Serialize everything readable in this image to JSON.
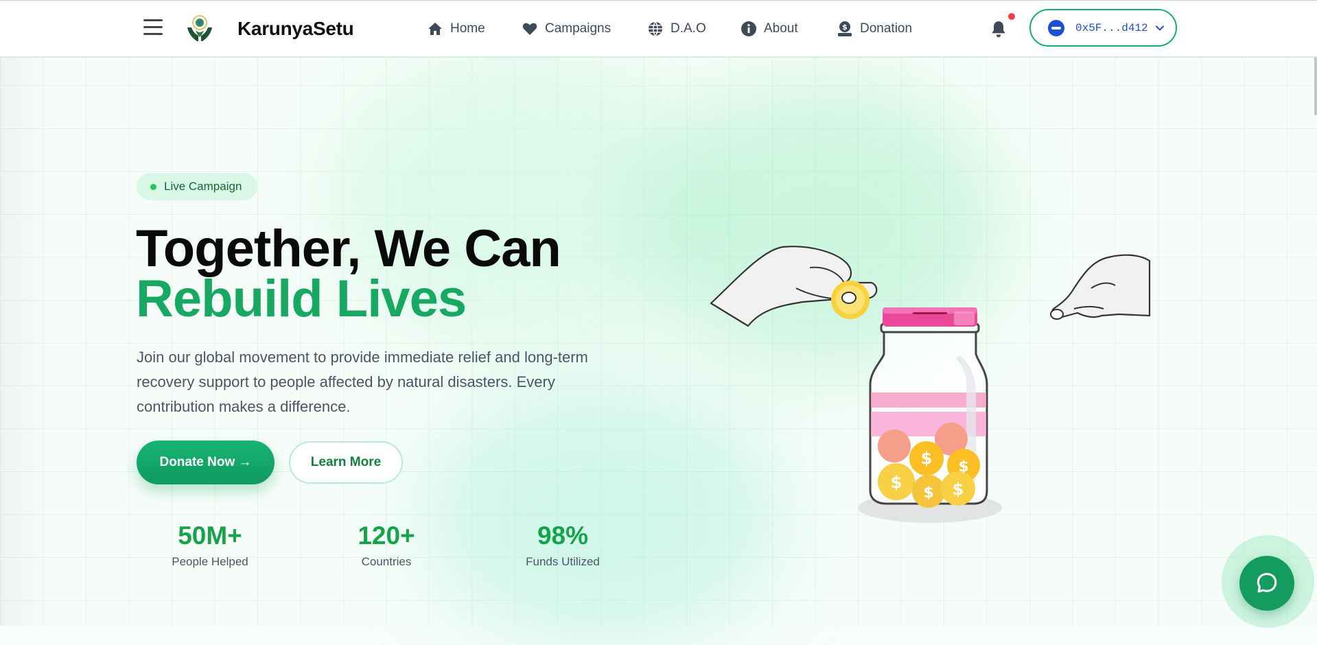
{
  "header": {
    "brand": "KarunyaSetu",
    "nav": [
      {
        "label": "Home",
        "icon": "home-icon"
      },
      {
        "label": "Campaigns",
        "icon": "heart-icon"
      },
      {
        "label": "D.A.O",
        "icon": "globe-icon"
      },
      {
        "label": "About",
        "icon": "info-icon"
      },
      {
        "label": "Donation",
        "icon": "donation-icon"
      }
    ],
    "wallet_address": "0x5F...d412",
    "notification_dot_color": "#ef4444"
  },
  "hero": {
    "badge": "Live Campaign",
    "title_line1": "Together, We Can",
    "title_line2": "Rebuild Lives",
    "description": "Join our global movement to provide immediate relief and long-term recovery support to people affected by natural disasters. Every contribution makes a difference.",
    "primary_button": "Donate Now →",
    "secondary_button": "Learn More",
    "stats": [
      {
        "value": "50M+",
        "label": "People Helped"
      },
      {
        "value": "120+",
        "label": "Countries"
      },
      {
        "value": "98%",
        "label": "Funds Utilized"
      }
    ]
  },
  "colors": {
    "accent": "#17a862",
    "wallet": "#1d4ed8",
    "jar_lid": "#ec4899",
    "coin": "#facc15"
  }
}
